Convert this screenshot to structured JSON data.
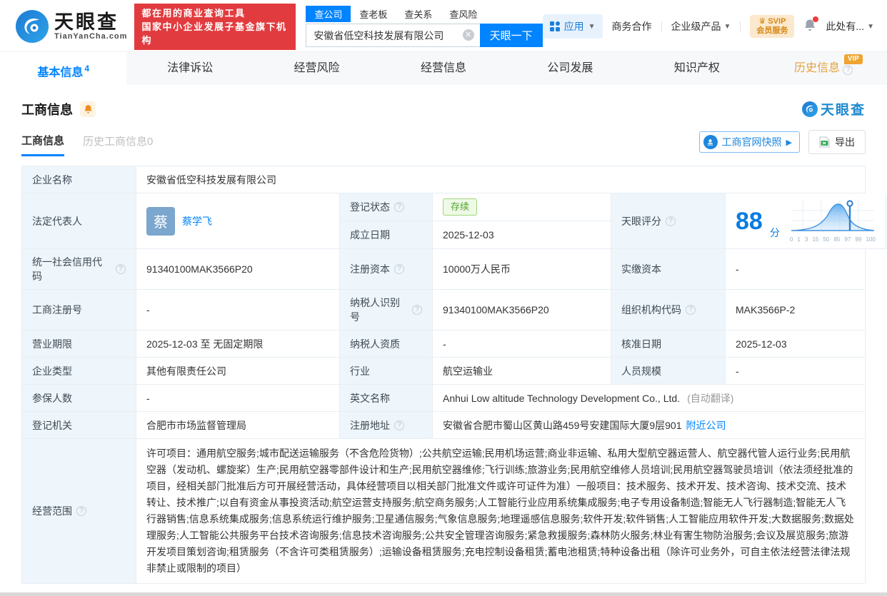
{
  "header": {
    "logo": {
      "title": "天眼查",
      "subtitle": "TianYanCha.com"
    },
    "slogan_line1": "都在用的商业查询工具",
    "slogan_line2": "国家中小企业发展子基金旗下机构",
    "search": {
      "tabs": [
        "查公司",
        "查老板",
        "查关系",
        "查风险"
      ],
      "active_tab": "查公司",
      "query": "安徽省低空科技发展有限公司",
      "button": "天眼一下"
    },
    "nav": {
      "apps": "应用",
      "biz_coop": "商务合作",
      "enterprise": "企业级产品",
      "svip_line1": "SVIP",
      "svip_line2": "会员服务",
      "more": "此处有..."
    }
  },
  "tabs": {
    "items": [
      "基本信息",
      "法律诉讼",
      "经营风险",
      "经营信息",
      "公司发展",
      "知识产权",
      "历史信息"
    ],
    "active": "基本信息",
    "count": "4",
    "vip": "VIP"
  },
  "section": {
    "title": "工商信息",
    "watermark": "天眼查",
    "subtab_active": "工商信息",
    "subtab_history": "历史工商信息0",
    "snapshot_button": "工商官网快照",
    "export_button": "导出"
  },
  "table": {
    "company_name": {
      "label": "企业名称",
      "value": "安徽省低空科技发展有限公司"
    },
    "legal_rep": {
      "label": "法定代表人",
      "avatar": "蔡",
      "name": "蔡学飞"
    },
    "reg_status": {
      "label": "登记状态",
      "badge": "存续"
    },
    "establish_date": {
      "label": "成立日期",
      "value": "2025-12-03"
    },
    "score": {
      "label": "天眼评分",
      "value": "88",
      "unit": "分",
      "ticks": [
        "0",
        "1",
        "3",
        "15",
        "50",
        "85",
        "97",
        "99",
        "100"
      ]
    },
    "credit_code": {
      "label": "统一社会信用代码",
      "value": "91340100MAK3566P20"
    },
    "reg_capital": {
      "label": "注册资本",
      "value": "10000万人民币"
    },
    "paid_capital": {
      "label": "实缴资本",
      "value": "-"
    },
    "reg_number": {
      "label": "工商注册号",
      "value": "-"
    },
    "taxpayer_id": {
      "label": "纳税人识别号",
      "value": "91340100MAK3566P20"
    },
    "org_code": {
      "label": "组织机构代码",
      "value": "MAK3566P-2"
    },
    "business_term": {
      "label": "营业期限",
      "value": "2025-12-03 至 无固定期限"
    },
    "taxpayer_qualification": {
      "label": "纳税人资质",
      "value": "-"
    },
    "approval_date": {
      "label": "核准日期",
      "value": "2025-12-03"
    },
    "company_type": {
      "label": "企业类型",
      "value": "其他有限责任公司"
    },
    "industry": {
      "label": "行业",
      "value": "航空运输业"
    },
    "staff_size": {
      "label": "人员规模",
      "value": "-"
    },
    "insured_count": {
      "label": "参保人数",
      "value": "-"
    },
    "english_name": {
      "label": "英文名称",
      "value": "Anhui Low altitude Technology Development Co., Ltd.",
      "note": "(自动翻译)"
    },
    "reg_authority": {
      "label": "登记机关",
      "value": "合肥市市场监督管理局"
    },
    "reg_address": {
      "label": "注册地址",
      "value": "安徽省合肥市蜀山区黄山路459号安建国际大厦9层901",
      "link": "附近公司"
    },
    "business_scope": {
      "label": "经营范围",
      "value": "许可项目：通用航空服务;城市配送运输服务（不含危险货物）;公共航空运输;民用机场运营;商业非运输、私用大型航空器运营人、航空器代管人运行业务;民用航空器（发动机、螺旋桨）生产;民用航空器零部件设计和生产;民用航空器维修;飞行训练;旅游业务;民用航空维修人员培训;民用航空器驾驶员培训（依法须经批准的项目，经相关部门批准后方可开展经营活动，具体经营项目以相关部门批准文件或许可证件为准）一般项目：技术服务、技术开发、技术咨询、技术交流、技术转让、技术推广;以自有资金从事投资活动;航空运营支持服务;航空商务服务;人工智能行业应用系统集成服务;电子专用设备制造;智能无人飞行器制造;智能无人飞行器销售;信息系统集成服务;信息系统运行维护服务;卫星通信服务;气象信息服务;地理遥感信息服务;软件开发;软件销售;人工智能应用软件开发;大数据服务;数据处理服务;人工智能公共服务平台技术咨询服务;信息技术咨询服务;公共安全管理咨询服务;紧急救援服务;森林防火服务;林业有害生物防治服务;会议及展览服务;旅游开发项目策划咨询;租赁服务（不含许可类租赁服务）;运输设备租赁服务;充电控制设备租赁;蓄电池租赁;特种设备出租（除许可业务外，可自主依法经营法律法规非禁止或限制的项目）"
    }
  }
}
